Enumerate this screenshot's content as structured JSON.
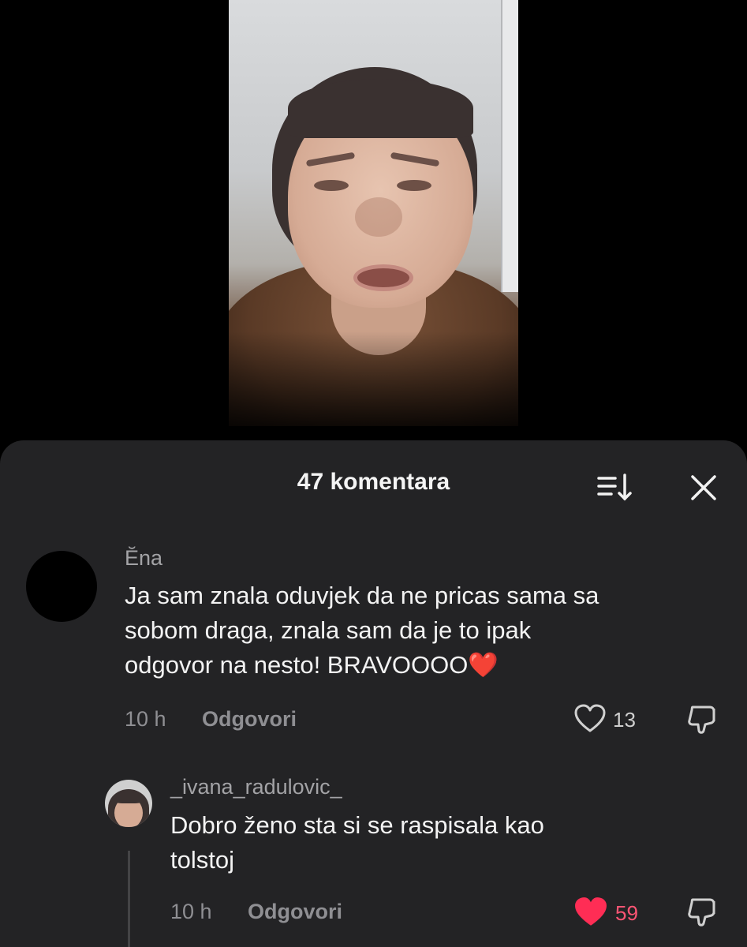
{
  "comments_header": {
    "title": "47 komentara",
    "sort_icon": "sort-descending-icon",
    "close_icon": "close-icon"
  },
  "comments": [
    {
      "username": "Ĕna",
      "avatar": "black-circle",
      "text_lines": [
        "Ja sam znala oduvjek da ne pricas sama sa",
        "sobom draga, znala sam da je to ipak",
        "odgovor na nesto! BRAVOOOO❤️"
      ],
      "time": "10 h",
      "reply_label": "Odgovori",
      "likes": "13",
      "liked": false,
      "like_color": "#cfcfcf"
    },
    {
      "username": "_ivana_radulovic_",
      "avatar": "user-photo",
      "text_lines": [
        "Dobro ženo sta si se raspisala kao",
        "tolstoj"
      ],
      "time": "10 h",
      "reply_label": "Odgovori",
      "likes": "59",
      "liked": true,
      "like_color": "#ff2d55"
    }
  ]
}
